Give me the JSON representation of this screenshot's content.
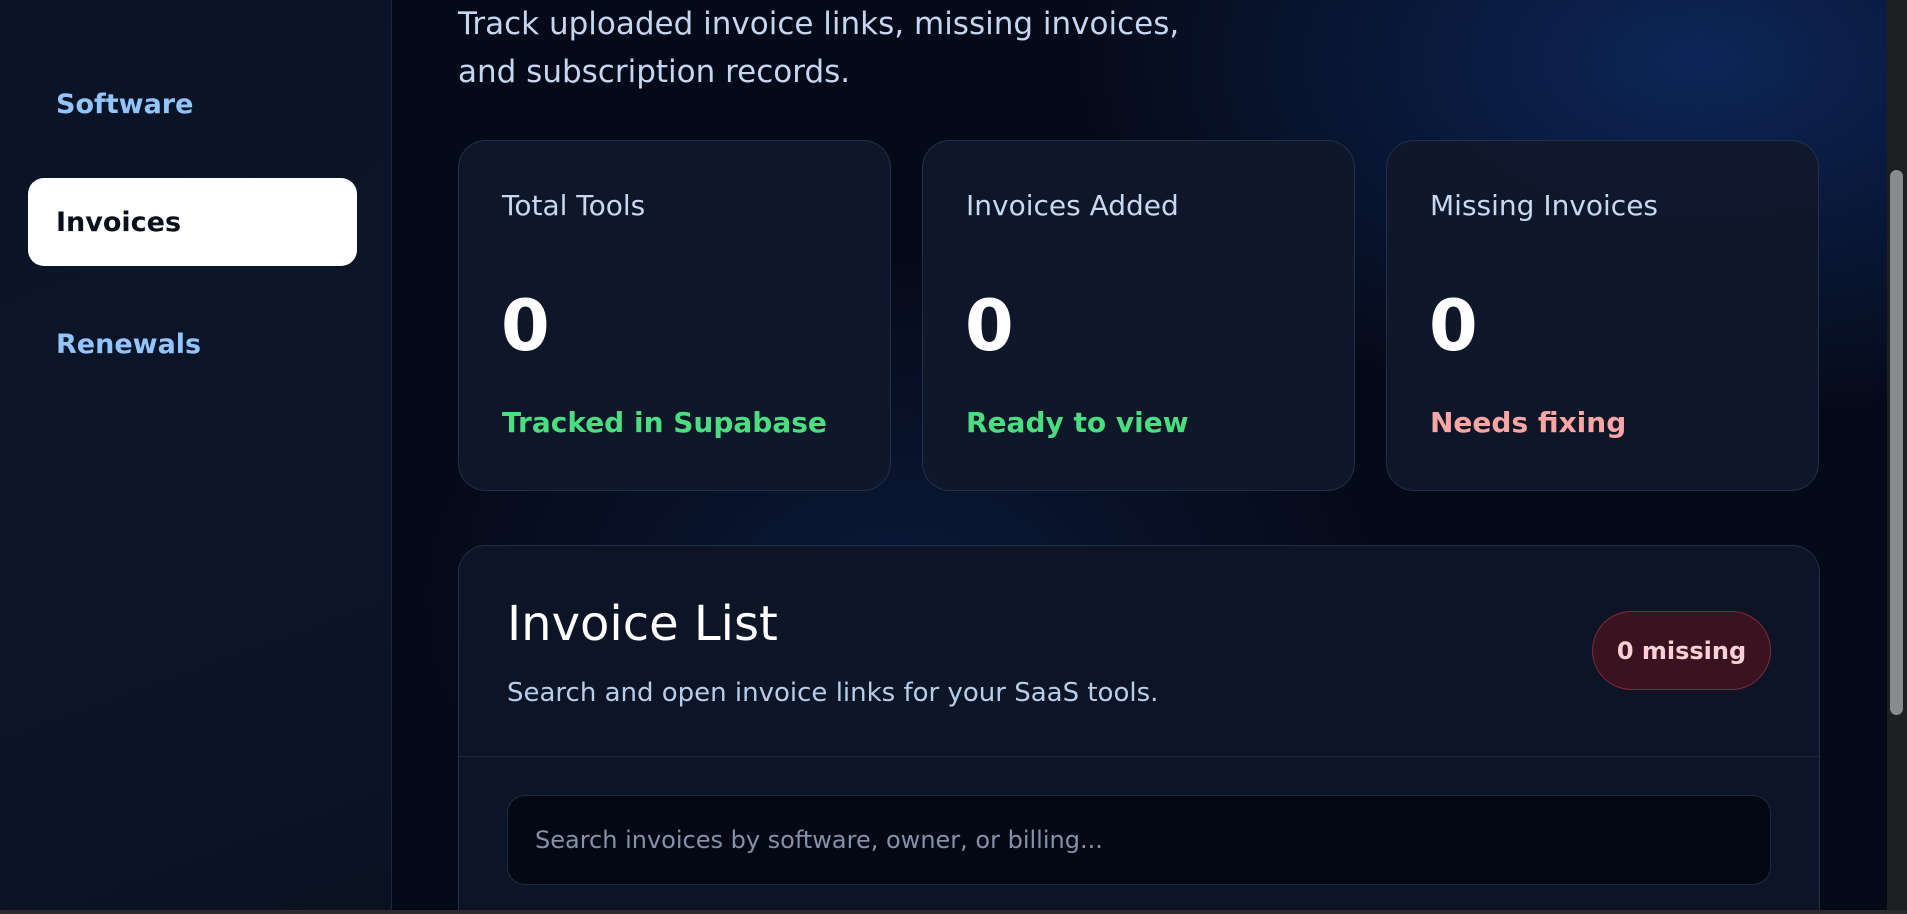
{
  "sidebar": {
    "items": [
      {
        "label": "Software",
        "active": false
      },
      {
        "label": "Invoices",
        "active": true
      },
      {
        "label": "Renewals",
        "active": false
      }
    ]
  },
  "main": {
    "intro": "Track uploaded invoice links, missing invoices, and subscription records.",
    "stats": [
      {
        "label": "Total Tools",
        "value": "0",
        "sub": "Tracked in Supabase",
        "sub_color": "#4ade80"
      },
      {
        "label": "Invoices Added",
        "value": "0",
        "sub": "Ready to view",
        "sub_color": "#4ade80"
      },
      {
        "label": "Missing Invoices",
        "value": "0",
        "sub": "Needs fixing",
        "sub_color": "#fca5a5"
      }
    ],
    "invoice_list": {
      "title": "Invoice List",
      "description": "Search and open invoice links for your SaaS tools.",
      "badge": "0 missing",
      "search_placeholder": "Search invoices by software, owner, or billing...",
      "search_value": ""
    }
  },
  "colors": {
    "accent_blue": "#93c5fd",
    "success": "#4ade80",
    "danger": "#fca5a5"
  }
}
